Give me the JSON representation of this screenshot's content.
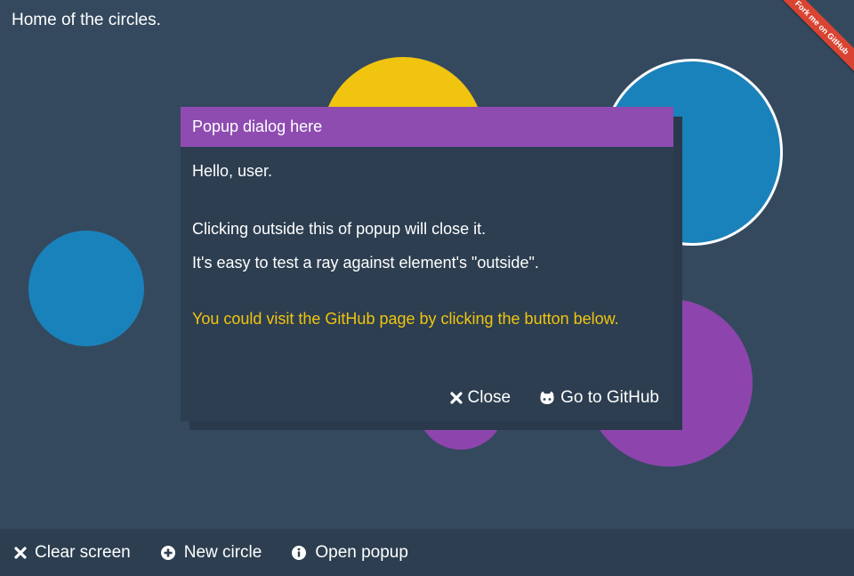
{
  "page": {
    "title": "Home of the circles."
  },
  "ribbon": {
    "label": "Fork me on GitHub"
  },
  "popup": {
    "header": "Popup dialog here",
    "greeting": "Hello, user.",
    "line1": "Clicking outside this of popup will close it.",
    "line2": "It's easy to test a ray against element's \"outside\".",
    "highlight": "You could visit the GitHub page by clicking the button below.",
    "close_label": "Close",
    "github_label": "Go to GitHub"
  },
  "toolbar": {
    "clear_label": "Clear screen",
    "new_circle_label": "New circle",
    "open_popup_label": "Open popup"
  },
  "icons": {
    "close": "close-icon",
    "github": "github-icon",
    "plus": "plus-circle-icon",
    "info": "info-circle-icon"
  },
  "colors": {
    "background": "#34495e",
    "bar": "#2c3e50",
    "popup_header": "#8e4cb1",
    "highlight": "#f1c40f",
    "circle_yellow": "#f1c40f",
    "circle_blue": "#1a82bb",
    "circle_purple": "#8e44ad",
    "ribbon": "#d94432"
  }
}
